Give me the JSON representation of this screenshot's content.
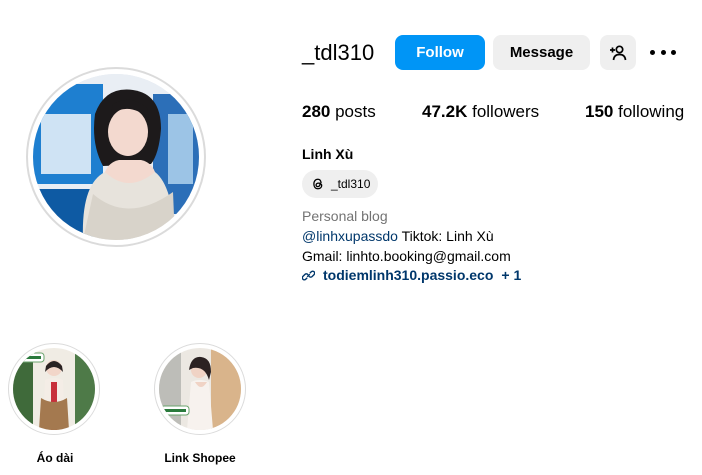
{
  "profile": {
    "username": "_tdl310",
    "follow_label": "Follow",
    "message_label": "Message",
    "stats": {
      "posts_count": "280",
      "posts_label": " posts",
      "followers_count": "47.2K",
      "followers_label": " followers",
      "following_count": "150",
      "following_label": " following"
    },
    "full_name": "Linh Xù",
    "threads_handle": "_tdl310",
    "category": "Personal blog",
    "bio": {
      "mention": "@linhxupassdo",
      "line1_rest": " Tiktok: Linh Xù",
      "line2": "Gmail: linhto.booking@gmail.com"
    },
    "link": {
      "text": "todiemlinh310.passio.eco",
      "more": "+ 1"
    }
  },
  "highlights": [
    {
      "label": "Áo dài"
    },
    {
      "label": "Link Shopee"
    }
  ],
  "colors": {
    "accent": "#0095f6",
    "link": "#00376b",
    "secondary_button": "#efefef",
    "muted_text": "#737373"
  },
  "icons": {
    "suggest": "add-person-icon",
    "more": "more-options-icon",
    "threads": "threads-logo-icon",
    "link": "link-icon"
  }
}
